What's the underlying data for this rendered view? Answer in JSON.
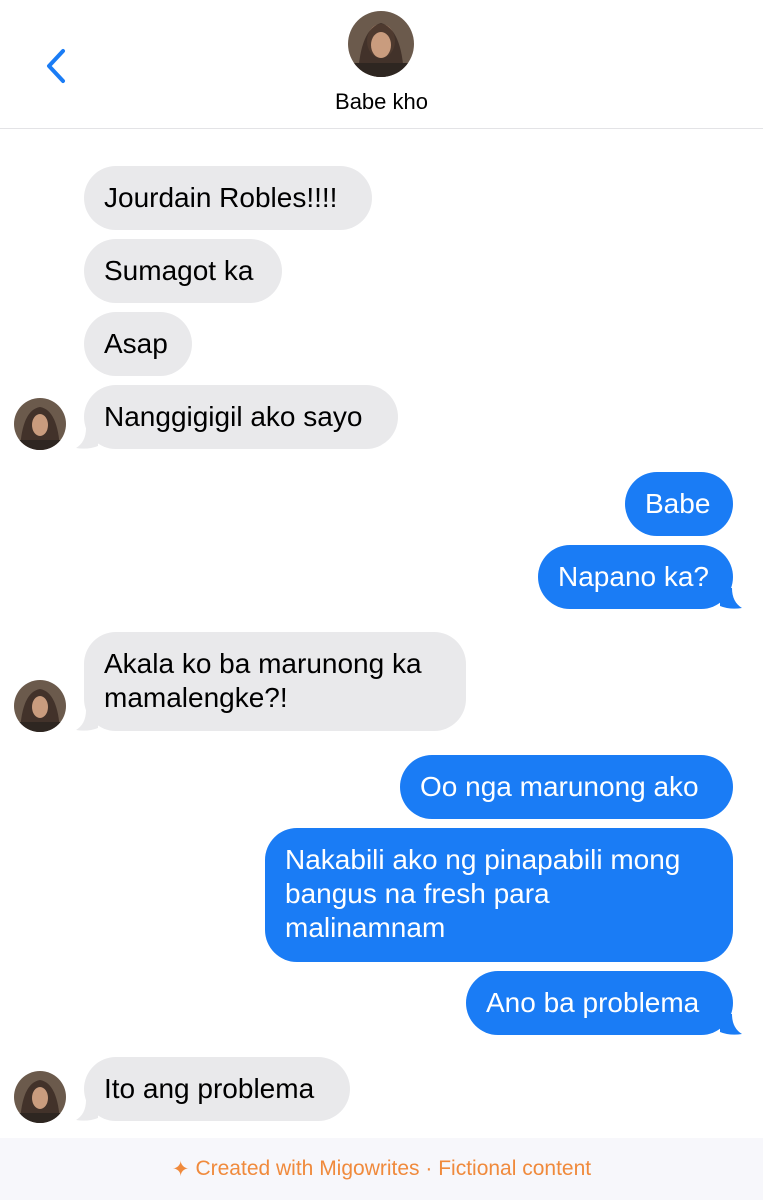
{
  "header": {
    "back_icon": "chevron-left-icon",
    "contact_name": "Babe kho"
  },
  "colors": {
    "incoming_bubble": "#e9e9eb",
    "outgoing_bubble": "#1a7cf5",
    "accent": "#1a7cf5",
    "footer_text": "#f08a3c"
  },
  "messages": [
    {
      "from": "them",
      "text": "Jourdain Robles!!!!"
    },
    {
      "from": "them",
      "text": "Sumagot ka"
    },
    {
      "from": "them",
      "text": "Asap"
    },
    {
      "from": "them",
      "text": "Nanggigigil ako sayo"
    },
    {
      "from": "me",
      "text": "Babe"
    },
    {
      "from": "me",
      "text": "Napano ka?"
    },
    {
      "from": "them",
      "text": "Akala ko ba marunong ka mamalengke?!"
    },
    {
      "from": "me",
      "text": "Oo nga marunong ako"
    },
    {
      "from": "me",
      "text": "Nakabili ako ng pinapabili mong bangus na fresh para malinamnam"
    },
    {
      "from": "me",
      "text": "Ano ba problema"
    },
    {
      "from": "them",
      "text": "Ito ang problema"
    }
  ],
  "footer": {
    "icon": "sparkle-icon",
    "star": "✦",
    "text": "Created with Migowrites · Fictional content"
  }
}
